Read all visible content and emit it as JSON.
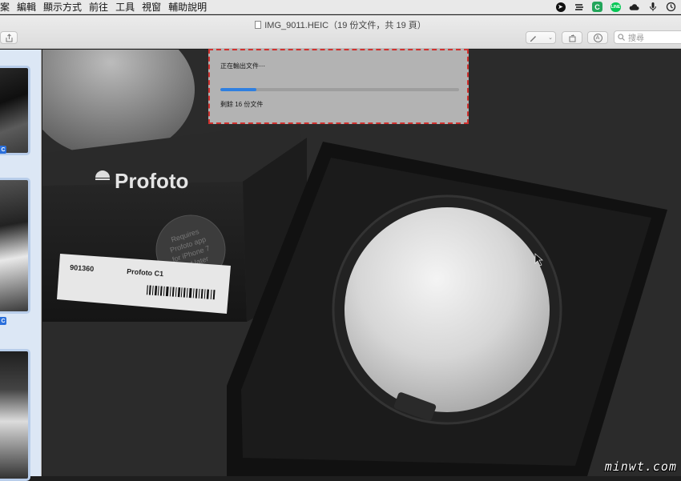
{
  "menubar": {
    "items": [
      "案",
      "編輯",
      "顯示方式",
      "前往",
      "工具",
      "視窗",
      "輔助說明"
    ],
    "status_icons": [
      "location-arrow-icon",
      "stripes-icon",
      "c-app-icon",
      "line-app-icon",
      "cloud-icon",
      "microphone-icon",
      "time-machine-icon"
    ],
    "c_label": "C",
    "line_label": "LINE"
  },
  "toolbar": {
    "window_title": "IMG_9011.HEIC（19 份文件，共 19 頁）",
    "search_placeholder": "搜尋"
  },
  "sidebar": {
    "badge_label": "C",
    "thumbnails": 3
  },
  "photo": {
    "brand": "Profoto",
    "box_label_code": "901360",
    "box_label_product": "Profoto C1",
    "sticker_text": [
      "Requires",
      "Profoto app",
      "for iPhone 7",
      "and later"
    ]
  },
  "export_dialog": {
    "title": "正在輸出文件⋯",
    "progress": 0.15,
    "remaining_text": "剩餘 16 份文件"
  },
  "watermark": "minwt.com",
  "colors": {
    "progress_fill": "#2f7fe0",
    "dialog_border": "#d0322f",
    "sidebar_bg": "#dce7f5"
  }
}
